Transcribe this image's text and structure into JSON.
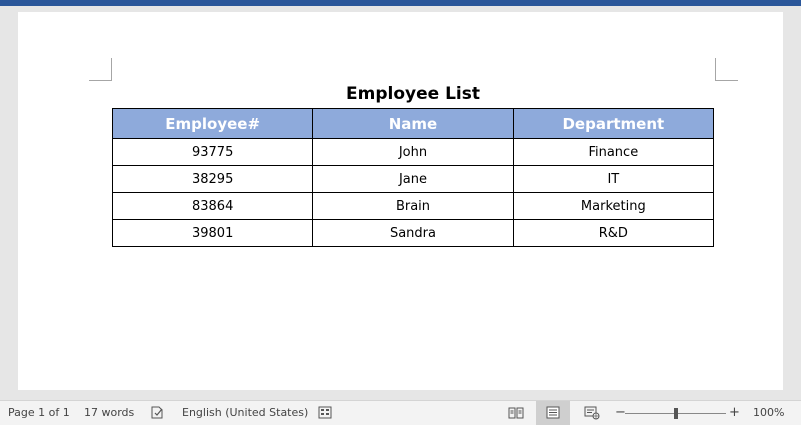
{
  "document": {
    "title": "Employee List",
    "table": {
      "headers": [
        "Employee#",
        "Name",
        "Department"
      ],
      "rows": [
        [
          "93775",
          "John",
          "Finance"
        ],
        [
          "38295",
          "Jane",
          "IT"
        ],
        [
          "83864",
          "Brain",
          "Marketing"
        ],
        [
          "39801",
          "Sandra",
          "R&D"
        ]
      ]
    }
  },
  "status": {
    "page": "Page 1 of 1",
    "words": "17 words",
    "language": "English (United States)",
    "zoom_minus": "−",
    "zoom_plus": "+",
    "zoom": "100%",
    "zoom_value_percent": 100
  },
  "colors": {
    "title_bar": "#2b579a",
    "table_header": "#8eaadb"
  },
  "icons": {
    "proofing": "proofing-icon",
    "macro": "macro-icon",
    "read_mode": "read-mode-icon",
    "print_layout": "print-layout-icon",
    "web_layout": "web-layout-icon"
  }
}
